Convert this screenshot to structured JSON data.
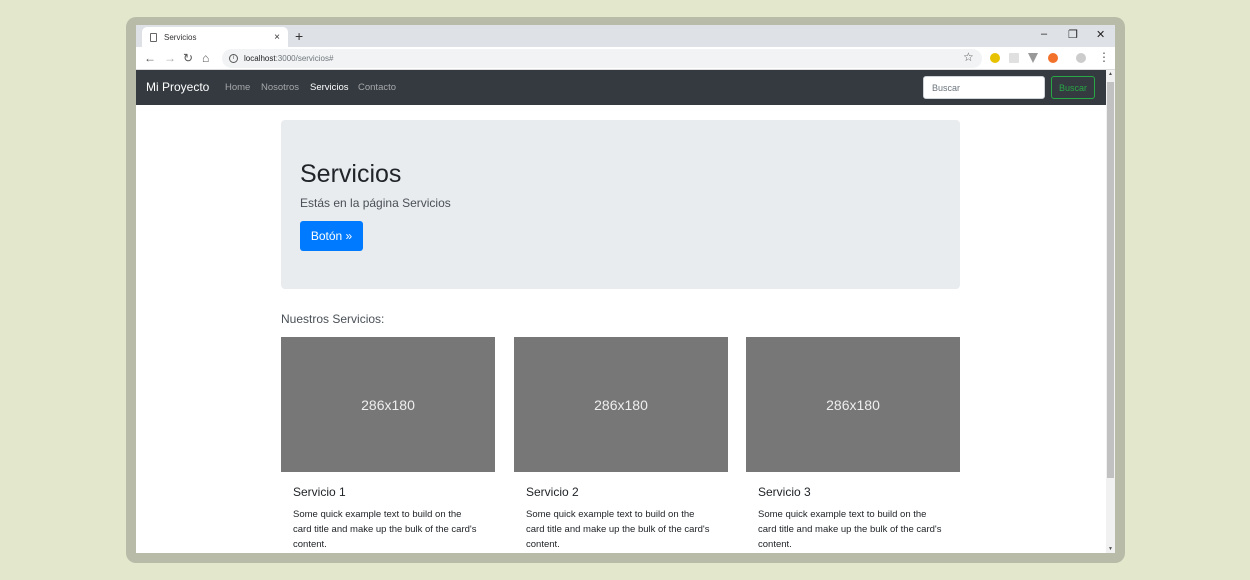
{
  "browser": {
    "tab_title": "Servicios",
    "tab_close": "×",
    "new_tab": "+",
    "window_minimize": "–",
    "window_restore": "❐",
    "window_close": "✕",
    "url_host": "localhost",
    "url_path": ":3000/servicios#",
    "nav_back": "←",
    "nav_forward": "→",
    "nav_reload": "↻",
    "nav_home": "⌂",
    "bookmark_star": "☆",
    "menu": "⋮",
    "info": "i"
  },
  "navbar": {
    "brand": "Mi Proyecto",
    "links": [
      "Home",
      "Nosotros",
      "Servicios",
      "Contacto"
    ],
    "active": "Servicios",
    "search_placeholder": "Buscar",
    "search_button": "Buscar"
  },
  "jumbotron": {
    "title": "Servicios",
    "lead": "Estás en la página Servicios",
    "button": "Botón »"
  },
  "section": {
    "title": "Nuestros Servicios:"
  },
  "cards": [
    {
      "image_label": "286x180",
      "title": "Servicio 1",
      "text": "Some quick example text to build on the card title and make up the bulk of the card's content."
    },
    {
      "image_label": "286x180",
      "title": "Servicio 2",
      "text": "Some quick example text to build on the card title and make up the bulk of the card's content."
    },
    {
      "image_label": "286x180",
      "title": "Servicio 3",
      "text": "Some quick example text to build on the card title and make up the bulk of the card's content."
    }
  ],
  "colors": {
    "navbar_bg": "#343a40",
    "primary": "#007bff",
    "success": "#28a745",
    "jumbotron_bg": "#e9ecef",
    "placeholder_img": "#777777"
  }
}
